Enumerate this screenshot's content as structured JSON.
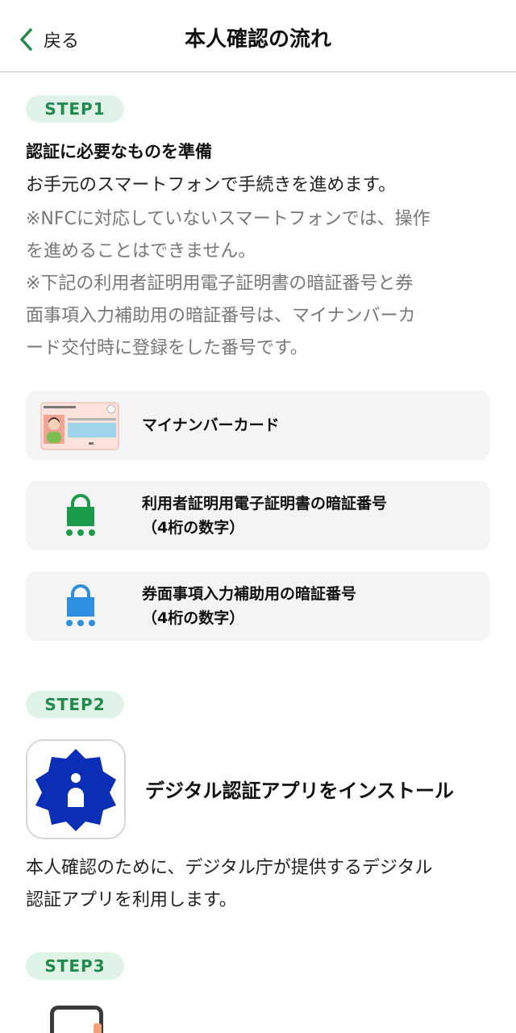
{
  "header": {
    "back_label": "戻る",
    "title": "本人確認の流れ"
  },
  "step1": {
    "badge": "STEP1",
    "heading": "認証に必要なものを準備",
    "description": "お手元のスマートフォンで手続きを進めます。",
    "note1_line1": "※NFCに対応していないスマートフォンでは、操作",
    "note1_line2": "を進めることはできません。",
    "note2_line1": "※下記の利用者証明用電子証明書の暗証番号と券",
    "note2_line2": "面事項入力補助用の暗証番号は、マイナンバーカ",
    "note2_line3": "ード交付時に登録をした番号です。",
    "items": [
      {
        "label": "マイナンバーカード",
        "icon": "my-number-card-icon"
      },
      {
        "label_line1": "利用者証明用電子証明書の暗証番号",
        "label_line2": "（4桁の数字）",
        "icon": "green-lock-icon"
      },
      {
        "label_line1": "券面事項入力補助用の暗証番号",
        "label_line2": "（4桁の数字）",
        "icon": "blue-lock-icon"
      }
    ]
  },
  "step2": {
    "badge": "STEP2",
    "title": "デジタル認証アプリをインストール",
    "description_line1": "本人確認のために、デジタル庁が提供するデジタル",
    "description_line2": "認証アプリを利用します。",
    "app_icon": "digital-auth-app-icon"
  },
  "step3": {
    "badge": "STEP3",
    "icon": "smartphone-icon"
  },
  "colors": {
    "accent_green": "#1f8a4c",
    "badge_bg": "#dff3e6",
    "lock_green": "#1a9a4a",
    "lock_blue": "#2e8fe0",
    "app_blue": "#0a2fb6",
    "card_bg": "#f4f4f4"
  }
}
